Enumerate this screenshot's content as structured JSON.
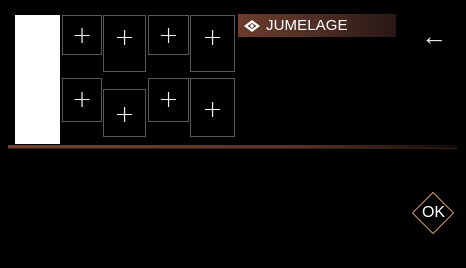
{
  "header": {
    "title": "JUMELAGE",
    "title_icon": "diamond-eye-icon",
    "back_icon": "back-arrow-icon",
    "back_symbol": "←"
  },
  "pairing_slots": {
    "slot_1": "+",
    "slot_2": "+",
    "slot_3": "+",
    "slot_4": "+",
    "slot_5": "+",
    "slot_6": "+",
    "slot_7": "+",
    "slot_8": "+"
  },
  "footer": {
    "ok_label": "OK"
  },
  "colors": {
    "background": "#000000",
    "title_bar_start": "#6b3c2c",
    "title_bar_end": "#281814",
    "accent": "#d39b66"
  }
}
